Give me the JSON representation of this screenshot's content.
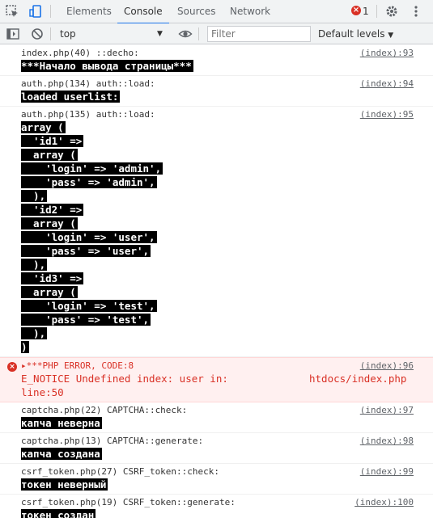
{
  "tabs": [
    "Elements",
    "Console",
    "Sources",
    "Network"
  ],
  "error_count": "1",
  "toolbar": {
    "context": "top",
    "filter_placeholder": "Filter",
    "levels": "Default levels"
  },
  "messages": [
    {
      "header": "index.php(40) ::decho:",
      "source": "(index):93",
      "lines": [
        "***Начало вывода страницы***"
      ]
    },
    {
      "header": "auth.php(134) auth::load:",
      "source": "(index):94",
      "lines": [
        "loaded userlist:"
      ]
    },
    {
      "header": "auth.php(135) auth::load:",
      "source": "(index):95",
      "lines": [
        "array (",
        "  'id1' =>",
        "  array (",
        "    'login' => 'admin',",
        "    'pass' => 'admin',",
        "  ),",
        "  'id2' =>",
        "  array (",
        "    'login' => 'user',",
        "    'pass' => 'user',",
        "  ),",
        "  'id3' =>",
        "  array (",
        "    'login' => 'test',",
        "    'pass' => 'test',",
        "  ),",
        ")"
      ]
    }
  ],
  "error": {
    "title": "***PHP ERROR, CODE:8",
    "source": "(index):96",
    "message": "E_NOTICE Undefined index: user in:",
    "path": "htdocs/index.php",
    "line": "line:50"
  },
  "messages2": [
    {
      "header": "captcha.php(22) CAPTCHA::check:",
      "source": "(index):97",
      "lines": [
        "капча неверна"
      ]
    },
    {
      "header": "captcha.php(13) CAPTCHA::generate:",
      "source": "(index):98",
      "lines": [
        "капча создана"
      ]
    },
    {
      "header": "csrf_token.php(27) CSRF_token::check:",
      "source": "(index):99",
      "lines": [
        "токен неверный"
      ]
    },
    {
      "header": "csrf_token.php(19) CSRF_token::generate:",
      "source": "(index):100",
      "lines": [
        "токен создан"
      ]
    }
  ]
}
